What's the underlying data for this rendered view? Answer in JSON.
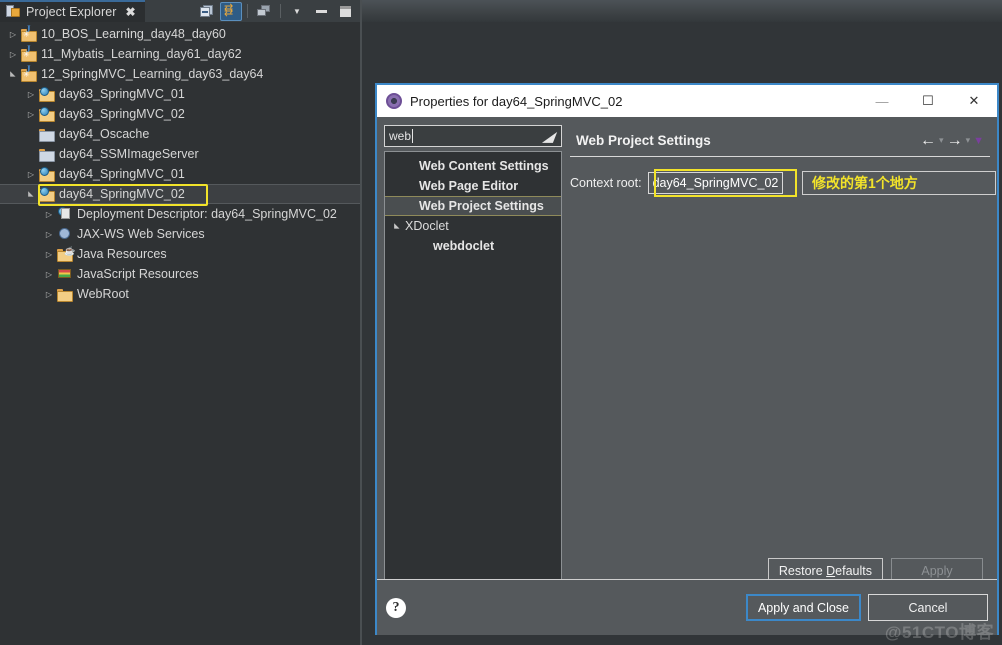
{
  "explorer": {
    "tab_title": "Project Explorer",
    "close_icon": "✖",
    "toolbar": [
      {
        "name": "collapse-all-icon",
        "label": "Collapse All"
      },
      {
        "name": "link-with-editor-icon",
        "label": "Link with Editor"
      },
      {
        "name": "view-menu-filter-icon",
        "label": "Filters"
      },
      {
        "name": "view-menu-icon",
        "label": "View Menu"
      },
      {
        "name": "minimize-icon",
        "label": "Minimize"
      },
      {
        "name": "maximize-icon",
        "label": "Maximize"
      }
    ],
    "tree": [
      {
        "label": "10_BOS_Learning_day48_day60",
        "indent": 0,
        "twisty": "collapsed",
        "icon": "java-project-folder"
      },
      {
        "label": "11_Mybatis_Learning_day61_day62",
        "indent": 0,
        "twisty": "collapsed",
        "icon": "java-project-folder"
      },
      {
        "label": "12_SpringMVC_Learning_day63_day64",
        "indent": 0,
        "twisty": "expanded",
        "icon": "java-project-folder"
      },
      {
        "label": "day63_SpringMVC_01",
        "indent": 1,
        "twisty": "collapsed",
        "icon": "web-project"
      },
      {
        "label": "day63_SpringMVC_02",
        "indent": 1,
        "twisty": "collapsed",
        "icon": "web-project"
      },
      {
        "label": "day64_Oscache",
        "indent": 1,
        "twisty": "none",
        "icon": "plain-folder"
      },
      {
        "label": "day64_SSMImageServer",
        "indent": 1,
        "twisty": "none",
        "icon": "plain-folder"
      },
      {
        "label": "day64_SpringMVC_01",
        "indent": 1,
        "twisty": "collapsed",
        "icon": "web-project"
      },
      {
        "label": "day64_SpringMVC_02",
        "indent": 1,
        "twisty": "expanded",
        "icon": "web-project",
        "selected": true,
        "highlight": true
      },
      {
        "label": "Deployment Descriptor: day64_SpringMVC_02",
        "indent": 2,
        "twisty": "collapsed",
        "icon": "deployment-descriptor"
      },
      {
        "label": "JAX-WS Web Services",
        "indent": 2,
        "twisty": "collapsed",
        "icon": "web-services"
      },
      {
        "label": "Java Resources",
        "indent": 2,
        "twisty": "collapsed",
        "icon": "java-resources"
      },
      {
        "label": "JavaScript Resources",
        "indent": 2,
        "twisty": "collapsed",
        "icon": "javascript-resources"
      },
      {
        "label": "WebRoot",
        "indent": 2,
        "twisty": "collapsed",
        "icon": "open-folder"
      }
    ]
  },
  "dialog": {
    "title": "Properties for day64_SpringMVC_02",
    "window_buttons": {
      "minimize": "—",
      "maximize": "☐",
      "close": "✕"
    },
    "filter": {
      "value": "web",
      "clear_icon": "clear-filter-icon"
    },
    "nav_items": [
      {
        "label": "Web Content Settings",
        "indent": 1,
        "twisty": "none",
        "bold": true
      },
      {
        "label": "Web Page Editor",
        "indent": 1,
        "twisty": "none",
        "bold": true
      },
      {
        "label": "Web Project Settings",
        "indent": 1,
        "twisty": "none",
        "bold": true,
        "selected": true
      },
      {
        "label": "XDoclet",
        "indent": 0,
        "twisty": "expanded",
        "bold": false
      },
      {
        "label": "webdoclet",
        "indent": 2,
        "twisty": "none",
        "bold": true
      }
    ],
    "page": {
      "title": "Web Project Settings",
      "back_icon": "←",
      "forward_icon": "→",
      "menu_icon": "▼",
      "context_root_label": "Context root:",
      "context_root_value": "day64_SpringMVC_02",
      "annotation": "修改的第1个地方"
    },
    "buttons": {
      "restore_defaults": "Restore Defaults",
      "restore_defaults_mnemonic": "D",
      "apply": "Apply",
      "apply_and_close": "Apply and Close",
      "cancel": "Cancel",
      "help_icon": "?"
    }
  },
  "watermark": "@51CTO博客"
}
